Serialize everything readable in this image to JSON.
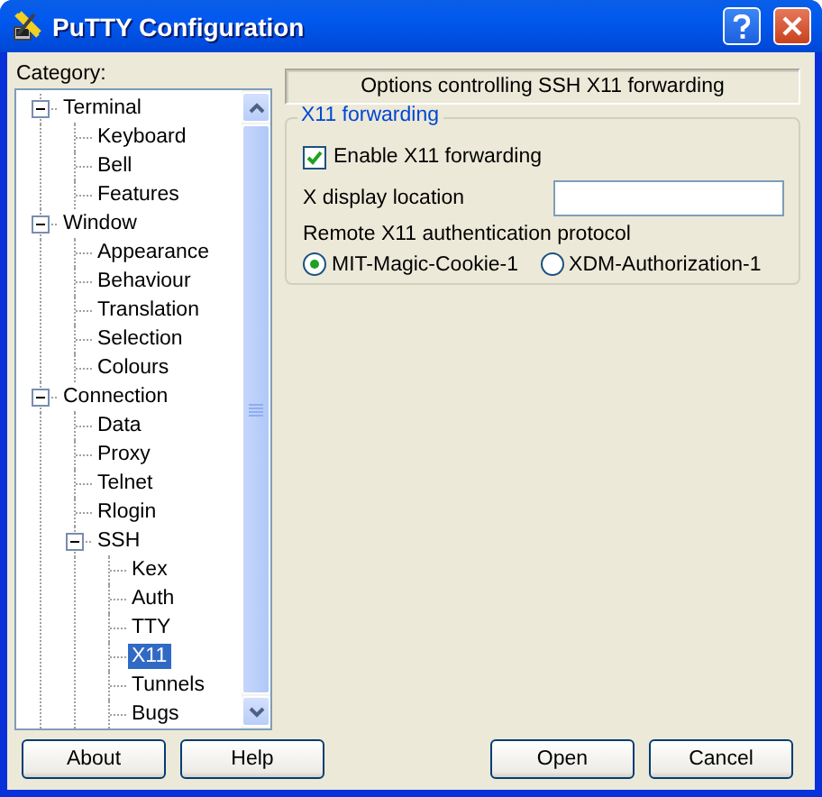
{
  "window": {
    "title": "PuTTY Configuration"
  },
  "category_label": "Category:",
  "tree": [
    {
      "label": "Terminal",
      "expanded": true,
      "selected": false,
      "children": [
        {
          "label": "Keyboard",
          "selected": false
        },
        {
          "label": "Bell",
          "selected": false
        },
        {
          "label": "Features",
          "selected": false
        }
      ]
    },
    {
      "label": "Window",
      "expanded": true,
      "selected": false,
      "children": [
        {
          "label": "Appearance",
          "selected": false
        },
        {
          "label": "Behaviour",
          "selected": false
        },
        {
          "label": "Translation",
          "selected": false
        },
        {
          "label": "Selection",
          "selected": false
        },
        {
          "label": "Colours",
          "selected": false
        }
      ]
    },
    {
      "label": "Connection",
      "expanded": true,
      "selected": false,
      "children": [
        {
          "label": "Data",
          "selected": false
        },
        {
          "label": "Proxy",
          "selected": false
        },
        {
          "label": "Telnet",
          "selected": false
        },
        {
          "label": "Rlogin",
          "selected": false
        },
        {
          "label": "SSH",
          "expanded": true,
          "selected": false,
          "children": [
            {
              "label": "Kex",
              "selected": false
            },
            {
              "label": "Auth",
              "selected": false
            },
            {
              "label": "TTY",
              "selected": false
            },
            {
              "label": "X11",
              "selected": true
            },
            {
              "label": "Tunnels",
              "selected": false
            },
            {
              "label": "Bugs",
              "selected": false
            }
          ]
        }
      ]
    }
  ],
  "panel": {
    "header": "Options controlling SSH X11 forwarding",
    "group": {
      "title": "X11 forwarding",
      "enable": {
        "label": "Enable X11 forwarding",
        "checked": true
      },
      "display": {
        "label": "X display location"
      },
      "protocol": {
        "label": "Remote X11 authentication protocol",
        "options": [
          {
            "label": "MIT-Magic-Cookie-1",
            "selected": true
          },
          {
            "label": "XDM-Authorization-1",
            "selected": false
          }
        ]
      }
    }
  },
  "buttons": {
    "left": [
      "About",
      "Help"
    ],
    "right": [
      "Open",
      "Cancel"
    ]
  }
}
